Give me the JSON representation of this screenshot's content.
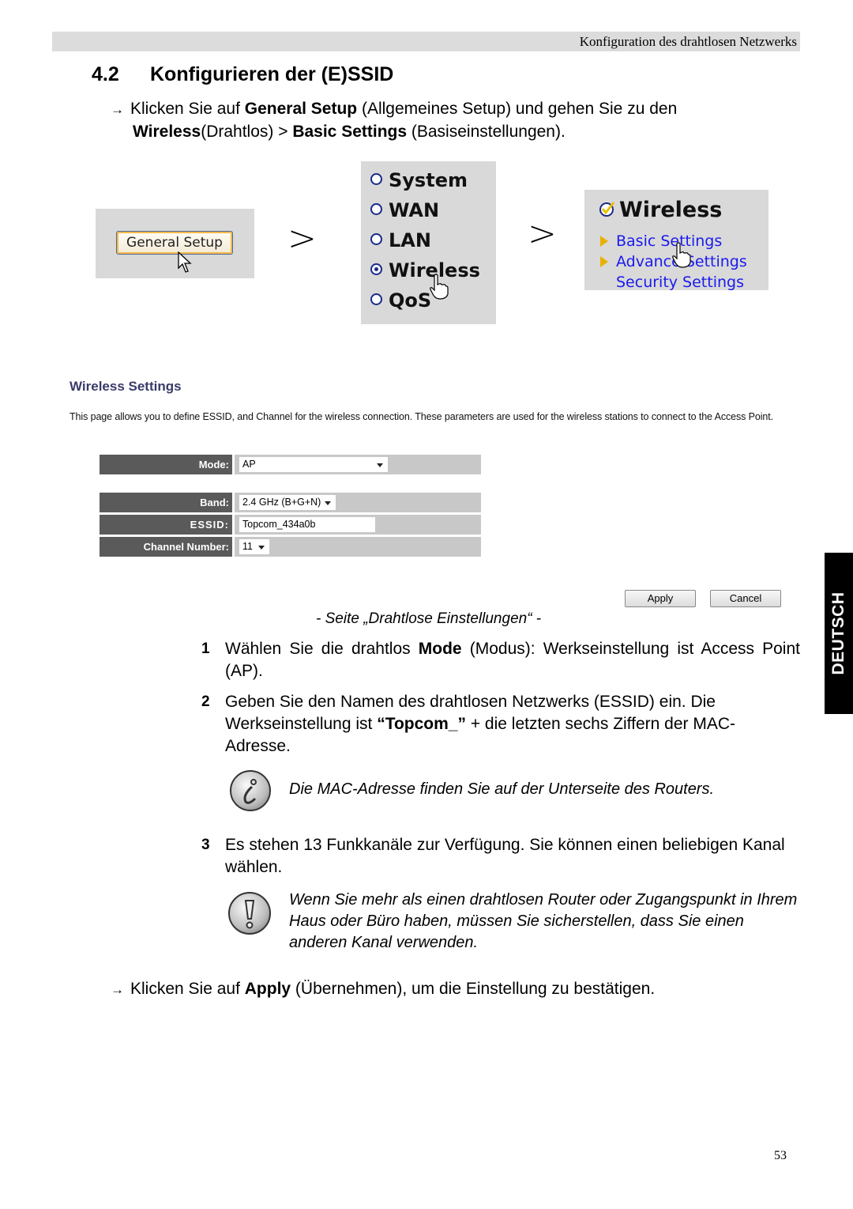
{
  "header": {
    "running_title": "Konfiguration des drahtlosen Netzwerks"
  },
  "section": {
    "number": "4.2",
    "title": "Konfigurieren der (E)SSID"
  },
  "intro": {
    "arrow": "→",
    "t1": "Klicken Sie auf ",
    "b1": "General Setup",
    "t2": " (Allgemeines Setup) und gehen Sie zu den",
    "b2": "Wireless",
    "t3": "(Drahtlos) > ",
    "b3": "Basic Settings",
    "t4": " (Basiseinstellungen)."
  },
  "nav_screens": {
    "general_setup_button": "General Setup",
    "separator": ">",
    "menu": [
      {
        "label": "System",
        "selected": false
      },
      {
        "label": "WAN",
        "selected": false
      },
      {
        "label": "LAN",
        "selected": false
      },
      {
        "label": "Wireless",
        "selected": true
      },
      {
        "label": "QoS",
        "selected": false
      }
    ],
    "submenu": {
      "title": "Wireless",
      "links": [
        "Basic Settings",
        "Advance Settings",
        "Security Settings"
      ]
    }
  },
  "wireless_settings": {
    "title": "Wireless Settings",
    "description": "This page allows you to define ESSID, and Channel for the wireless connection. These parameters are used for the wireless stations to connect to the Access Point.",
    "fields": {
      "mode": {
        "label": "Mode:",
        "value": "AP"
      },
      "band": {
        "label": "Band:",
        "value": "2.4 GHz (B+G+N)"
      },
      "essid": {
        "label": "ESSID:",
        "value": "Topcom_434a0b"
      },
      "channel": {
        "label": "Channel Number:",
        "value": "11"
      }
    },
    "apply": "Apply",
    "cancel": "Cancel"
  },
  "caption": "- Seite „Drahtlose Einstellungen“ -",
  "steps": [
    {
      "num": "1",
      "t1": "Wählen Sie die drahtlos ",
      "b1": "Mode",
      "t2": " (Modus): Werkseinstellung ist Access Point (AP)."
    },
    {
      "num": "2",
      "t1": "Geben Sie den Namen des drahtlosen Netzwerks (ESSID) ein. Die Werkseinstellung ist ",
      "b1": "“Topcom_”",
      "t2": " + die letzten sechs Ziffern der MAC-Adresse."
    },
    {
      "num": "3",
      "t1": "Es stehen 13 Funkkanäle zur Verfügung. Sie können einen beliebigen Kanal wählen."
    }
  ],
  "notes": {
    "info": "Die MAC-Adresse finden Sie auf der Unterseite des Routers.",
    "warning": "Wenn Sie mehr als einen drahtlosen Router oder Zugangspunkt in Ihrem Haus oder Büro haben, müssen Sie sicherstellen, dass Sie einen anderen Kanal verwenden."
  },
  "outro": {
    "arrow": "→",
    "t1": "Klicken Sie auf ",
    "b1": "Apply",
    "t2": " (Übernehmen), um die Einstellung zu bestätigen."
  },
  "language_tab": "DEUTSCH",
  "page_number": "53"
}
